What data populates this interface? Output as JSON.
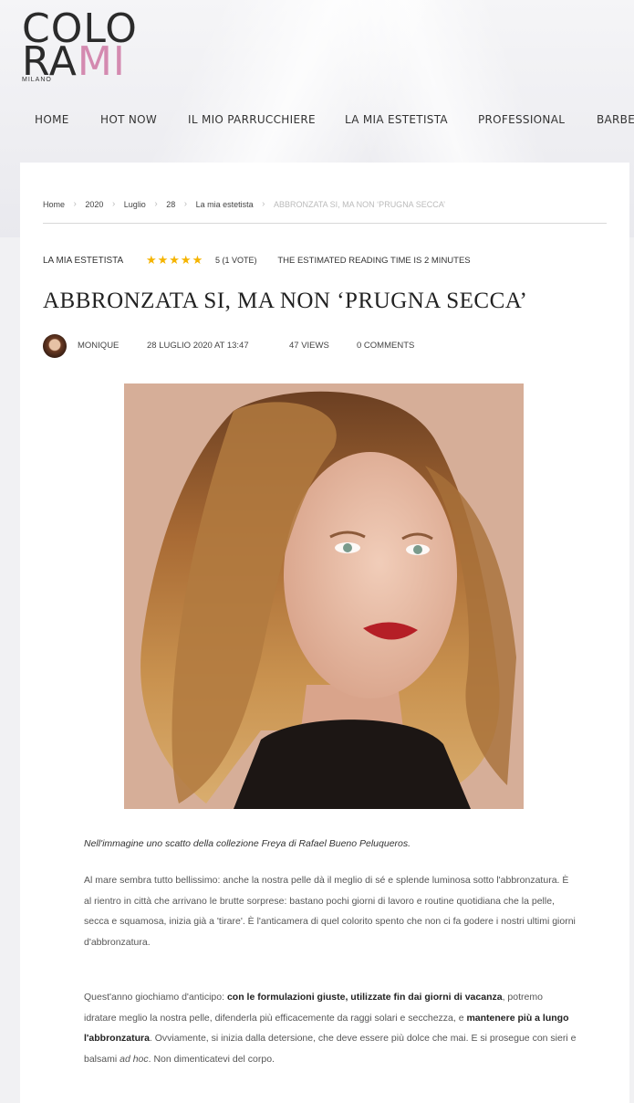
{
  "logo": {
    "line1": "COLO",
    "line2a": "RA",
    "line2b": "MI",
    "sub": "MILANO"
  },
  "nav": [
    "HOME",
    "HOT NOW",
    "IL MIO PARRUCCHIERE",
    "LA MIA ESTETISTA",
    "PROFESSIONAL",
    "BARBE"
  ],
  "breadcrumb": [
    "Home",
    "2020",
    "Luglio",
    "28",
    "La mia estetista",
    "ABBRONZATA SI, MA NON ‘PRUGNA SECCA’"
  ],
  "article": {
    "category": "LA MIA ESTETISTA",
    "stars": "★★★★★",
    "votes": "5 (1 VOTE)",
    "reading_time": "THE ESTIMATED READING TIME IS 2 MINUTES",
    "title": "ABBRONZATA SI, MA NON ‘PRUGNA SECCA’",
    "author": "MONIQUE",
    "date": "28 LUGLIO 2020 AT 13:47",
    "views": "47 VIEWS",
    "comments": "0 COMMENTS",
    "caption": "Nell'immagine uno scatto della collezione Freya di Rafael Bueno Peluqueros.",
    "p1": "Al mare sembra tutto bellissimo: anche la nostra pelle dà il meglio di sé e splende luminosa sotto l'abbronzatura. È al rientro in città che arrivano le brutte sorprese: bastano pochi giorni di lavoro e routine quotidiana che la pelle, secca e squamosa, inizia già a 'tirare'. È l'anticamera di quel colorito spento che non ci fa godere i nostri ultimi giorni d'abbronzatura.",
    "p2_a": "Quest'anno giochiamo d'anticipo: ",
    "p2_b": "con le formulazioni giuste, utilizzate fin dai giorni di vacanza",
    "p2_c": ", potremo idratare meglio la nostra pelle, difenderla più efficacemente da raggi solari e secchezza, e ",
    "p2_d": "mantenere più a lungo l'abbronzatura",
    "p2_e": ". Ovviamente, si inizia dalla detersione, che deve essere più dolce che mai. E si prosegue con sieri e balsami ",
    "p2_f": "ad hoc",
    "p2_g": ". Non dimenticatevi del corpo."
  },
  "colors": {
    "accent_pink": "#d48ab0",
    "stars": "#f5b400"
  }
}
